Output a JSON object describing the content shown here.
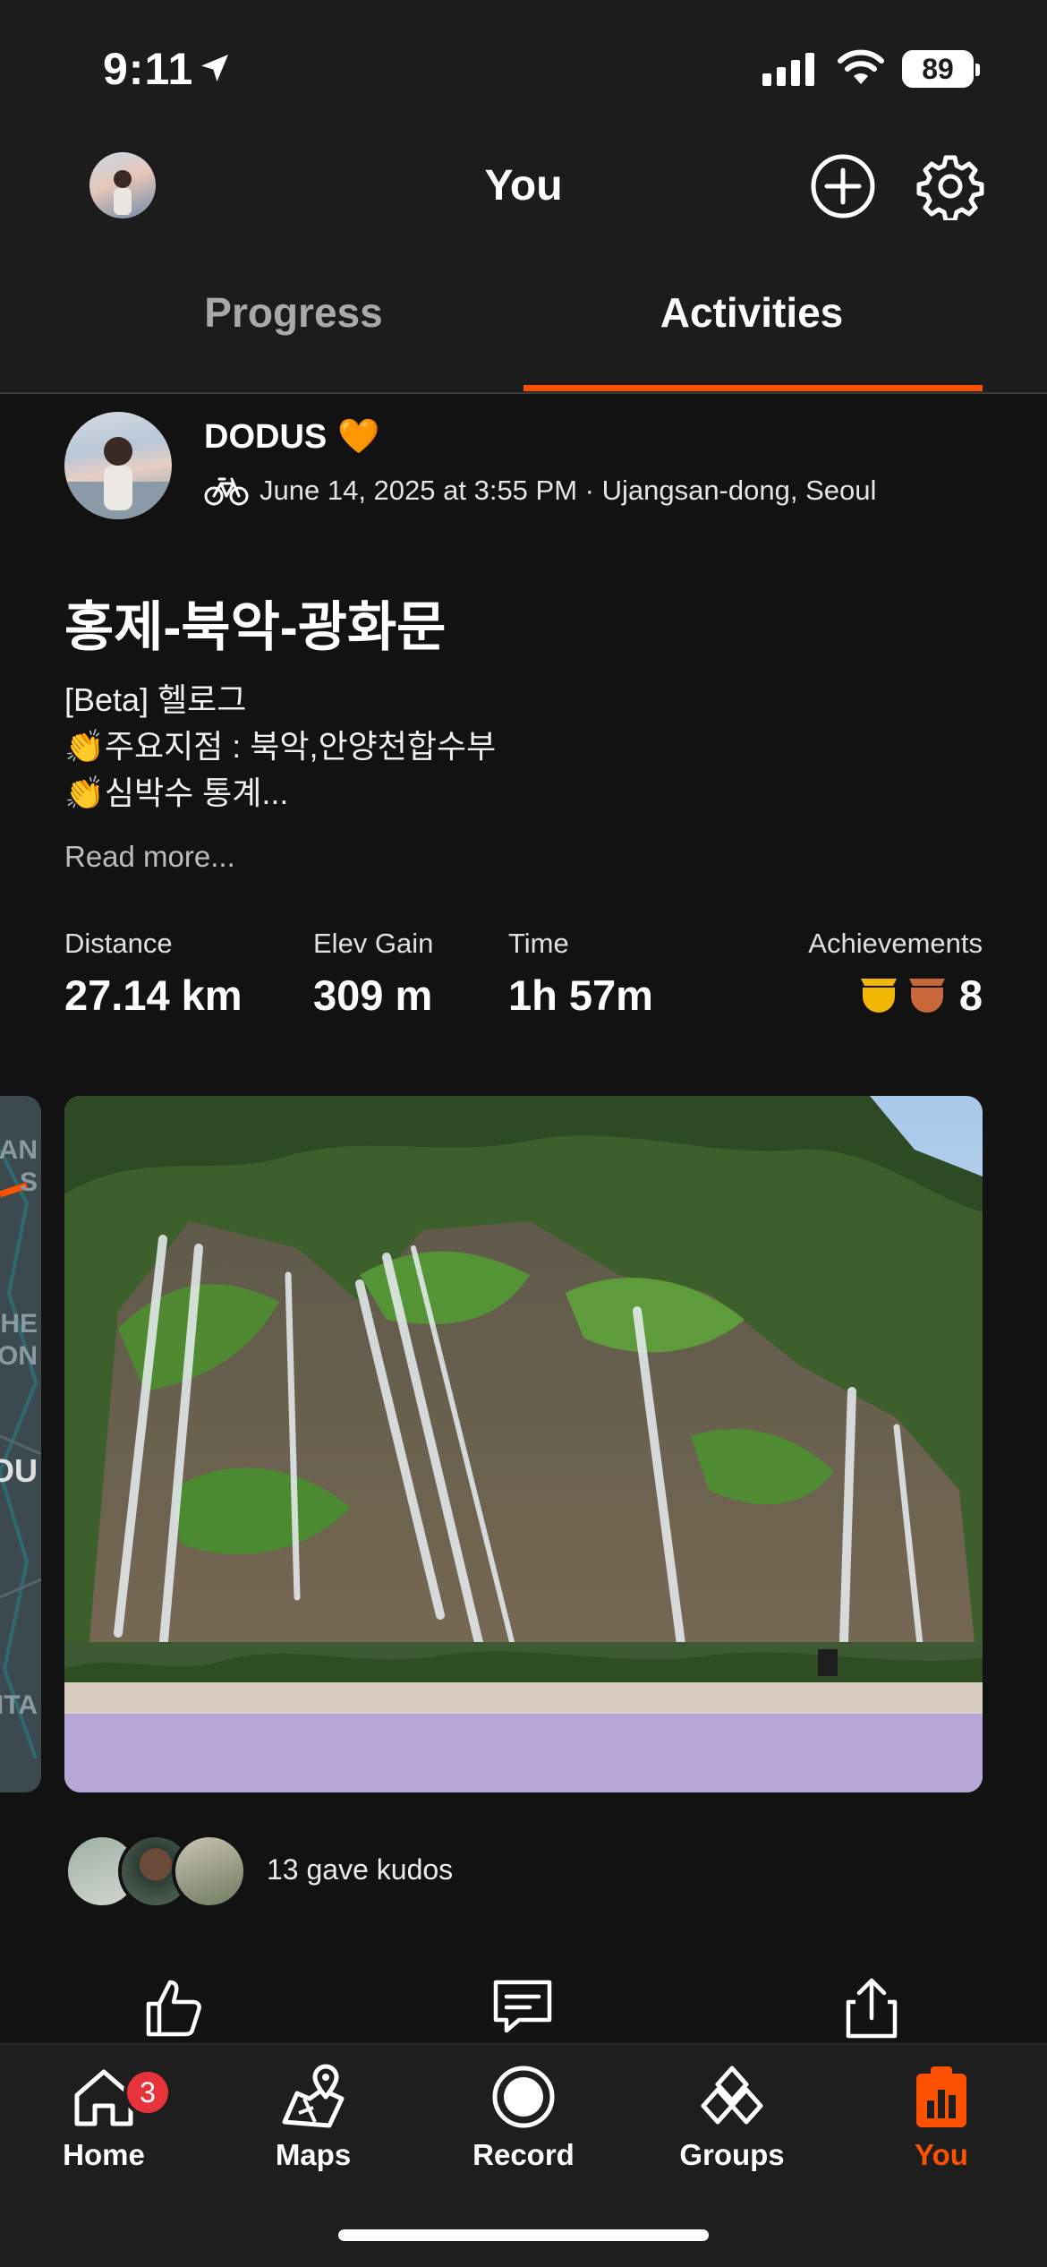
{
  "status_bar": {
    "time": "9:11",
    "battery": "89"
  },
  "header": {
    "title": "You"
  },
  "tabs": [
    {
      "label": "Progress",
      "selected": false
    },
    {
      "label": "Activities",
      "selected": true
    }
  ],
  "activity": {
    "athlete_name": "DODUS",
    "name_emoji": "🧡",
    "meta": "June 14, 2025 at 3:55 PM · Ujangsan-dong, Seoul",
    "title": "홍제-북악-광화문",
    "description_lines": [
      "[Beta] 헬로그",
      "👏주요지점 : 북악,안양천합수부",
      "👏심박수 통계..."
    ],
    "read_more": "Read more...",
    "stats": {
      "distance_label": "Distance",
      "distance_value": "27.14 km",
      "elev_label": "Elev Gain",
      "elev_value": "309 m",
      "time_label": "Time",
      "time_value": "1h 57m",
      "ach_label": "Achievements",
      "ach_value": "8"
    },
    "map_peek_labels": [
      "HAN",
      "S",
      "HE",
      "ON",
      "OU",
      "ITA"
    ],
    "kudos_text": "13 gave kudos"
  },
  "nav": {
    "home": "Home",
    "home_badge": "3",
    "maps": "Maps",
    "record": "Record",
    "groups": "Groups",
    "you": "You"
  },
  "colors": {
    "accent": "#fc5200",
    "background": "#121212",
    "badge": "#e8333a"
  }
}
